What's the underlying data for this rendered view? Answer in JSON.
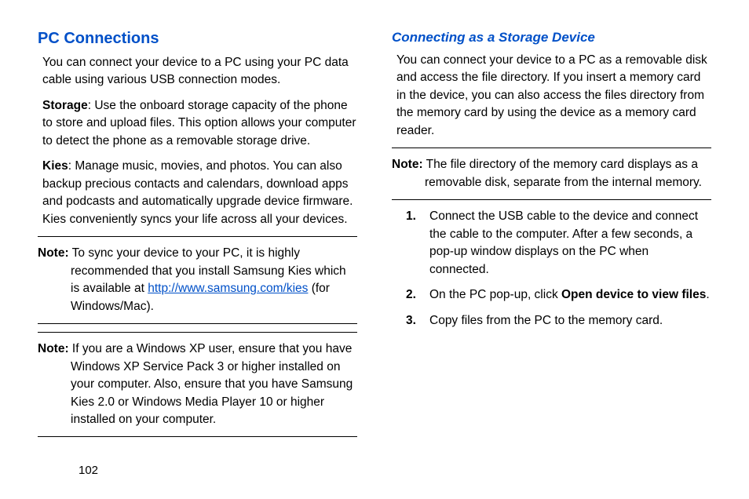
{
  "page_number": "102",
  "left": {
    "heading": "PC Connections",
    "intro": "You can connect your device to a PC using your PC data cable using various USB connection modes.",
    "storage_label": "Storage",
    "storage_text": ": Use the onboard storage capacity of the phone to store and upload files. This option allows your computer to detect the phone as a removable storage drive.",
    "kies_label": "Kies",
    "kies_text": ": Manage music, movies, and photos. You can also backup precious contacts and calendars, download apps and podcasts and automatically upgrade device firmware. Kies conveniently syncs your life across all your devices.",
    "note1_label": "Note:",
    "note1_pre": " To sync your device to your PC, it is highly recommended that you install Samsung Kies which is available at ",
    "note1_link": "http://www.samsung.com/kies",
    "note1_post": " (for Windows/Mac).",
    "note2_label": "Note:",
    "note2_text": " If you are a Windows XP user, ensure that you have Windows XP Service Pack 3 or higher installed on your computer. Also, ensure that you have Samsung Kies 2.0 or Windows Media Player 10 or higher installed on your computer."
  },
  "right": {
    "sub_heading": "Connecting as a Storage Device",
    "intro": "You can connect your device to a PC as a removable disk and access the file directory. If you insert a memory card in the device, you can also access the files directory from the memory card by using the device as a memory card reader.",
    "note_label": "Note:",
    "note_text": " The file directory of the memory card displays as a removable disk, separate from the internal memory.",
    "step1": "Connect the USB cable to the device and connect the cable to the computer. After a few seconds, a pop-up window displays on the PC when connected.",
    "step2_pre": "On the PC pop-up, click ",
    "step2_bold": "Open device to view files",
    "step2_post": ".",
    "step3": "Copy files from the PC to the memory card."
  }
}
